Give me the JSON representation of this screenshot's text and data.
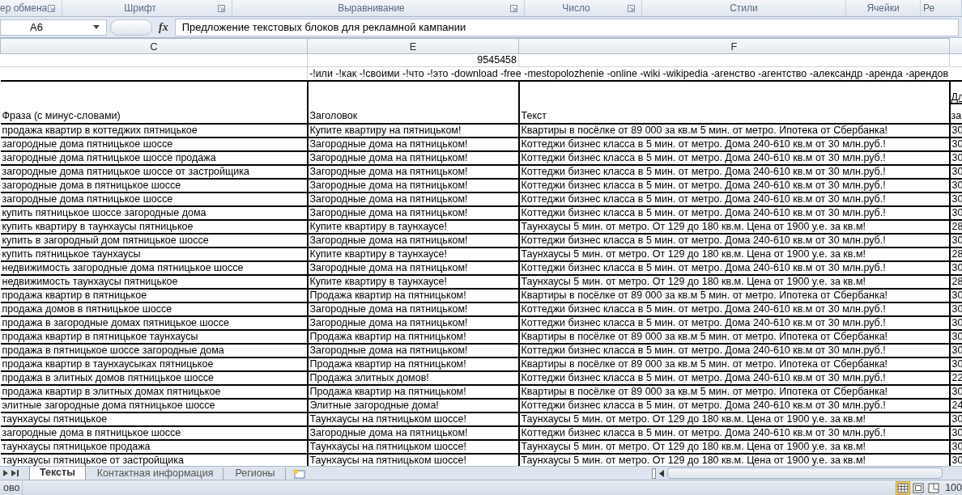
{
  "ribbon_groups": [
    {
      "label": "ер обмена",
      "launcher": true
    },
    {
      "label": "Шрифт",
      "launcher": true
    },
    {
      "label": "Выравнивание",
      "launcher": true
    },
    {
      "label": "Число",
      "launcher": true
    },
    {
      "label": "Стили",
      "launcher": false
    },
    {
      "label": "Ячейки",
      "launcher": false
    },
    {
      "label": "Ре",
      "launcher": false
    }
  ],
  "formula_bar": {
    "cell_ref": "A6",
    "fx_label": "fx",
    "formula": "Предложение текстовых блоков для рекламной кампании"
  },
  "sheet": {
    "columns": [
      "C",
      "E",
      "F"
    ],
    "number_cell": "9545458",
    "minus_words": "-!или -!как -!своими -!что -!это -download -free -mestopolozhenie -online -wiki -wikipedia -агенство -агентство -александр -аренда -арендов",
    "headers": [
      "Фраза (с минус-словами)",
      "Заголовок",
      "Текст"
    ],
    "column_4_header": [
      "Дл",
      "за"
    ],
    "rows": [
      [
        "продажа квартир в коттеджих пятницькое",
        "Купите квартиру на пятницьком!",
        "Квартиры в посёлке от 89 000 за кв.м 5 мин. от метро. Ипотека от Сбербанка!",
        "30"
      ],
      [
        "загородные дома пятницькое шоссе",
        "Загородные дома на пятницьком!",
        "Коттеджи бизнес класса в 5 мин. от метро. Дома 240-610 кв.м от 30 млн.руб.!",
        "30"
      ],
      [
        "загородные дома пятницькое шоссе продажа",
        "Загородные дома на пятницьком!",
        "Коттеджи бизнес класса в 5 мин. от метро. Дома 240-610 кв.м от 30 млн.руб.!",
        "30"
      ],
      [
        "загородные дома пятницькое шоссе от застройщика",
        "Загородные дома на пятницьком!",
        "Коттеджи бизнес класса в 5 мин. от метро. Дома 240-610 кв.м от 30 млн.руб.!",
        "30"
      ],
      [
        "загородные дома в пятницькое шоссе",
        "Загородные дома на пятницьком!",
        "Коттеджи бизнес класса в 5 мин. от метро. Дома 240-610 кв.м от 30 млн.руб.!",
        "30"
      ],
      [
        "загородные дома пятницькое шоссе",
        "Загородные дома на пятницьком!",
        "Коттеджи бизнес класса в 5 мин. от метро. Дома 240-610 кв.м от 30 млн.руб.!",
        "30"
      ],
      [
        "купить пятницькое шоссе загородные дома",
        "Загородные дома на пятницьком!",
        "Коттеджи бизнес класса в 5 мин. от метро. Дома 240-610 кв.м от 30 млн.руб.!",
        "30"
      ],
      [
        "купить квартиру в таунхаусы пятницькое",
        "Купите квартиру в таунхаусе!",
        "Таунхаусы 5 мин. от метро. От 129 до 180 кв.м. Цена от 1900 у.е. за кв.м!",
        "28"
      ],
      [
        "купить в загородный дом пятницькое шоссе",
        "Загородные дома на пятницьком!",
        "Коттеджи бизнес класса в 5 мин. от метро. Дома 240-610 кв.м от 30 млн.руб.!",
        "30"
      ],
      [
        "купить пятницькое таунхаусы",
        "Купите квартиру в таунхаусе!",
        "Таунхаусы 5 мин. от метро. От 129 до 180 кв.м. Цена от 1900 у.е. за кв.м!",
        "28"
      ],
      [
        "недвижимость загородные дома пятницькое шоссе",
        "Загородные дома на пятницьком!",
        "Коттеджи бизнес класса в 5 мин. от метро. Дома 240-610 кв.м от 30 млн.руб.!",
        "30"
      ],
      [
        "недвижимость таунхаусы пятницькое",
        "Купите квартиру в таунхаусе!",
        "Таунхаусы 5 мин. от метро. От 129 до 180 кв.м. Цена от 1900 у.е. за кв.м!",
        "28"
      ],
      [
        "продажа квартир в пятницькое",
        "Продажа квартир на пятницьком!",
        "Квартиры в посёлке от 89 000 за кв.м 5 мин. от метро. Ипотека от Сбербанка!",
        "30"
      ],
      [
        "продажа домов в пятницькое шоссе",
        "Загородные дома на пятницьком!",
        "Коттеджи бизнес класса в 5 мин. от метро. Дома 240-610 кв.м от 30 млн.руб.!",
        "30"
      ],
      [
        "продажа в загородные домах пятницькое шоссе",
        "Загородные дома на пятницьком!",
        "Коттеджи бизнес класса в 5 мин. от метро. Дома 240-610 кв.м от 30 млн.руб.!",
        "30"
      ],
      [
        "продажа квартир в пятницькое таунхаусы",
        "Продажа квартир на пятницьком!",
        "Квартиры в посёлке от 89 000 за кв.м 5 мин. от метро. Ипотека от Сбербанка!",
        "30"
      ],
      [
        "продажа в пятницькое шоссе загородные дома",
        "Загородные дома на пятницьком!",
        "Коттеджи бизнес класса в 5 мин. от метро. Дома 240-610 кв.м от 30 млн.руб.!",
        "30"
      ],
      [
        "продажа квартир в таунхаусыках пятницькое",
        "Продажа квартир на пятницьком!",
        "Квартиры в посёлке от 89 000 за кв.м 5 мин. от метро. Ипотека от Сбербанка!",
        "30"
      ],
      [
        "продажа в элитных домов пятницькое шоссе",
        "Продажа элитных домов!",
        "Коттеджи бизнес класса в 5 мин. от метро. Дома 240-610 кв.м от 30 млн.руб.!",
        "22"
      ],
      [
        "продажа квартир в элитных домах пятницькое",
        "Продажа квартир на пятницьком!",
        "Квартиры в посёлке от 89 000 за кв.м 5 мин. от метро. Ипотека от Сбербанка!",
        "30"
      ],
      [
        "элитные загородные дома пятницькое шоссе",
        "Элитные загородные дома!",
        "Коттеджи бизнес класса в 5 мин. от метро. Дома 240-610 кв.м от 30 млн.руб.!",
        "24"
      ],
      [
        "таунхаусы пятницькое",
        "Таунхаусы на пятницьком шоссе!",
        "Таунхаусы 5 мин. от метро. От 129 до 180 кв.м. Цена от 1900 у.е. за кв.м!",
        "30"
      ],
      [
        "загородные дома в пятницькое шоссе",
        "Загородные дома на пятницьком!",
        "Коттеджи бизнес класса в 5 мин. от метро. Дома 240-610 кв.м от 30 млн.руб.!",
        "30"
      ],
      [
        "таунхаусы пятницькое продажа",
        "Таунхаусы на пятницьком шоссе!",
        "Таунхаусы 5 мин. от метро. От 129 до 180 кв.м. Цена от 1900 у.е. за кв.м!",
        "30"
      ],
      [
        "таунхаусы пятницькое от застройщика",
        "Таунхаусы на пятницьком шоссе!",
        "Таунхаусы 5 мин. от метро. От 129 до 180 кв.м. Цена от 1900 у.е. за кв.м!",
        "30"
      ]
    ]
  },
  "sheet_tabs": [
    {
      "label": "Тексты",
      "selected": true
    },
    {
      "label": "Контактная информация",
      "selected": false
    },
    {
      "label": "Регионы",
      "selected": false
    }
  ],
  "status_bar": {
    "status": "ово",
    "views": [
      {
        "kind": "normal",
        "selected": true
      },
      {
        "kind": "layout",
        "selected": false
      },
      {
        "kind": "pagebreak",
        "selected": false
      }
    ],
    "zoom": "100"
  }
}
